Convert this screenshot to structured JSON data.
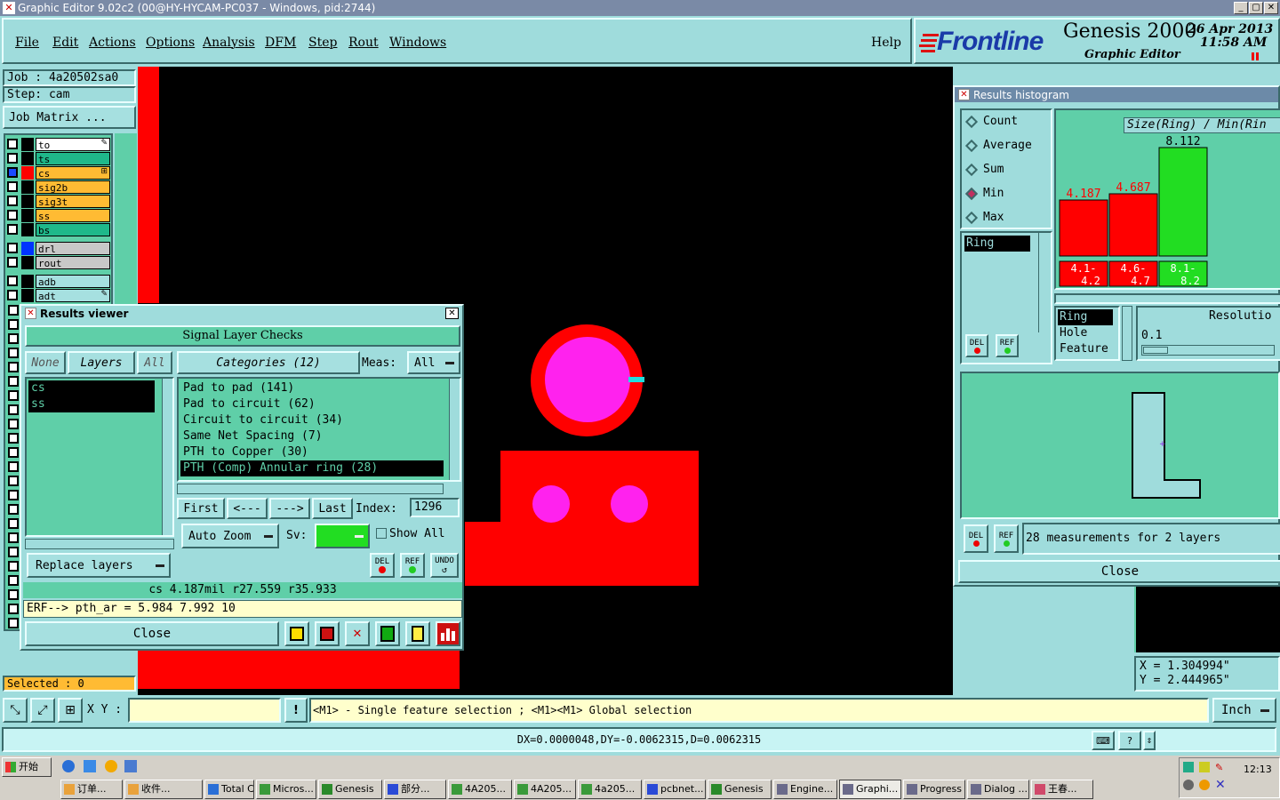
{
  "window": {
    "title": "Graphic Editor 9.02c2 (00@HY-HYCAM-PC037 - Windows, pid:2744)"
  },
  "menu": [
    "File",
    "Edit",
    "Actions",
    "Options",
    "Analysis",
    "DFM",
    "Step",
    "Rout",
    "Windows"
  ],
  "help": "Help",
  "brand": {
    "logo": "Frontline",
    "product": "Genesis 2000",
    "subtitle": "Graphic Editor",
    "date": "26 Apr 2013",
    "time": "11:58 AM"
  },
  "job": {
    "job_label": "Job : 4a20502sa0",
    "step_label": "Step: cam",
    "matrix_button": "Job Matrix ..."
  },
  "layers": [
    {
      "name": "to",
      "color": "#ffffff",
      "swatch": "#000000",
      "marker": "pencil"
    },
    {
      "name": "ts",
      "color": "#1fb88a",
      "swatch": "#000000"
    },
    {
      "name": "cs",
      "color": "#ffbb33",
      "swatch": "#ff0000",
      "marker": "plus"
    },
    {
      "name": "sig2b",
      "color": "#ffbb33",
      "swatch": "#000000"
    },
    {
      "name": "sig3t",
      "color": "#ffbb33",
      "swatch": "#000000"
    },
    {
      "name": "ss",
      "color": "#ffbb33",
      "swatch": "#000000"
    },
    {
      "name": "bs",
      "color": "#1fb88a",
      "swatch": "#000000"
    },
    {
      "name": "drl",
      "color": "#c8c8c8",
      "swatch": "#0033ff"
    },
    {
      "name": "rout",
      "color": "#c8c8c8",
      "swatch": "#000000"
    },
    {
      "name": "adb",
      "color": "#a6e0e0",
      "swatch": "#000000"
    },
    {
      "name": "adt",
      "color": "#a6e0e0",
      "swatch": "#000000",
      "marker": "pencil"
    }
  ],
  "selected": "Selected : 0",
  "results_viewer": {
    "title": "Results viewer",
    "heading": "Signal Layer Checks",
    "none_btn": "None",
    "layers_btn": "Layers",
    "all_btn": "All",
    "layer_list": [
      "cs",
      "ss"
    ],
    "categories_btn": "Categories (12)",
    "meas_label": "Meas:",
    "meas_value": "All",
    "categories": [
      "Pad to pad (141)",
      "Pad to circuit (62)",
      "Circuit to circuit (34)",
      "Same Net Spacing (7)",
      "PTH to Copper (30)",
      "PTH (Comp) Annular ring (28)"
    ],
    "nav": {
      "first": "First",
      "prev": "<---",
      "next": "--->",
      "last": "Last",
      "index_label": "Index:",
      "index_value": "1296"
    },
    "auto_zoom": "Auto Zoom",
    "sv_label": "Sv:",
    "show_all": "Show All",
    "replace_layers": "Replace layers",
    "del": "DEL",
    "ref": "REF",
    "undo": "UNDO",
    "status": "cs 4.187mil  r27.559  r35.933",
    "erf": "ERF--> pth_ar = 5.984 7.992 10",
    "close": "Close"
  },
  "histogram": {
    "title": "Results histogram",
    "modes": [
      "Count",
      "Average",
      "Sum",
      "Min",
      "Max"
    ],
    "selected_mode": "Min",
    "chart_title": "Size(Ring) / Min(Rin",
    "attr_list": [
      "Ring"
    ],
    "group_list": [
      "Ring",
      "Hole",
      "Feature"
    ],
    "resolution_label": "Resolutio",
    "resolution_value": "0.1",
    "measurements": "28 measurements for 2 layers",
    "del": "DEL",
    "ref": "REF",
    "close": "Close"
  },
  "chart_data": {
    "type": "bar",
    "categories": [
      "4.1-4.2",
      "4.6-4.7",
      "8.1-8.2"
    ],
    "values": [
      4.187,
      4.687,
      8.112
    ],
    "colors": [
      "#ff0000",
      "#ff0000",
      "#22dd22"
    ],
    "title": "Size(Ring) / Min(Rin"
  },
  "coords": {
    "x": "X = 1.304994\"",
    "y": "Y = 2.444965\""
  },
  "bottom": {
    "xy_label": "X Y :",
    "hint": "<M1> - Single feature selection ; <M1><M1> Global selection",
    "units": "Inch",
    "delta": "DX=0.0000048,DY=-0.0062315,D=0.0062315"
  },
  "taskbar": {
    "start": "开始",
    "clock": "12:13",
    "tasks": [
      "订单...",
      "收件...",
      "Total C...",
      "Micros...",
      "Genesis",
      "部分...",
      "4A205...",
      "4A205...",
      "4a205...",
      "pcbnet...",
      "Genesis",
      "Engine...",
      "Graphi...",
      "Progress",
      "Dialog ...",
      "王春..."
    ]
  }
}
